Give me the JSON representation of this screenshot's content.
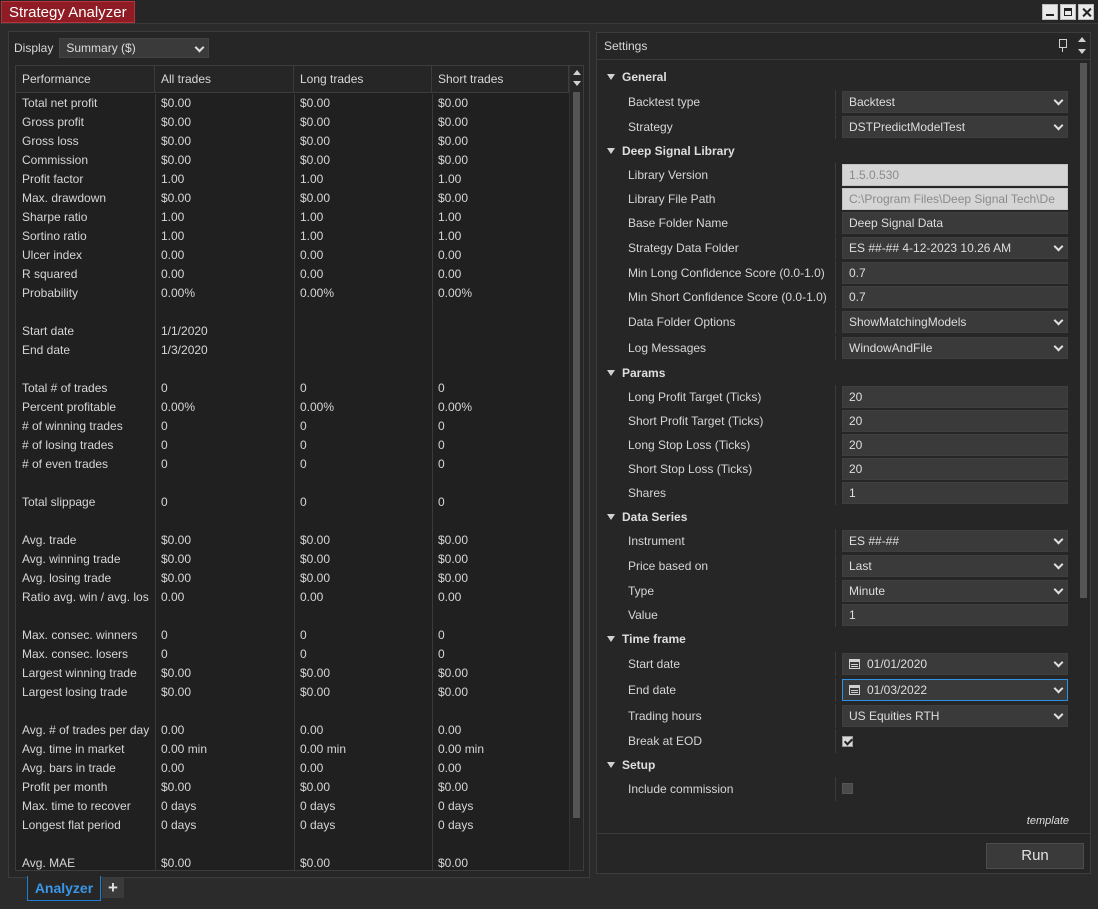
{
  "window": {
    "title": "Strategy Analyzer"
  },
  "display": {
    "label": "Display",
    "value": "Summary ($)"
  },
  "grid": {
    "headers": [
      "Performance",
      "All trades",
      "Long trades",
      "Short trades"
    ],
    "rows": [
      [
        "Total net profit",
        "$0.00",
        "$0.00",
        "$0.00"
      ],
      [
        "Gross profit",
        "$0.00",
        "$0.00",
        "$0.00"
      ],
      [
        "Gross loss",
        "$0.00",
        "$0.00",
        "$0.00"
      ],
      [
        "Commission",
        "$0.00",
        "$0.00",
        "$0.00"
      ],
      [
        "Profit factor",
        "1.00",
        "1.00",
        "1.00"
      ],
      [
        "Max. drawdown",
        "$0.00",
        "$0.00",
        "$0.00"
      ],
      [
        "Sharpe ratio",
        "1.00",
        "1.00",
        "1.00"
      ],
      [
        "Sortino ratio",
        "1.00",
        "1.00",
        "1.00"
      ],
      [
        "Ulcer index",
        "0.00",
        "0.00",
        "0.00"
      ],
      [
        "R squared",
        "0.00",
        "0.00",
        "0.00"
      ],
      [
        "Probability",
        "0.00%",
        "0.00%",
        "0.00%"
      ],
      [
        "",
        "",
        "",
        ""
      ],
      [
        "Start date",
        "1/1/2020",
        "",
        ""
      ],
      [
        "End date",
        "1/3/2020",
        "",
        ""
      ],
      [
        "",
        "",
        "",
        ""
      ],
      [
        "Total # of trades",
        "0",
        "0",
        "0"
      ],
      [
        "Percent profitable",
        "0.00%",
        "0.00%",
        "0.00%"
      ],
      [
        "# of winning trades",
        "0",
        "0",
        "0"
      ],
      [
        "# of losing trades",
        "0",
        "0",
        "0"
      ],
      [
        "# of even trades",
        "0",
        "0",
        "0"
      ],
      [
        "",
        "",
        "",
        ""
      ],
      [
        "Total slippage",
        "0",
        "0",
        "0"
      ],
      [
        "",
        "",
        "",
        ""
      ],
      [
        "Avg. trade",
        "$0.00",
        "$0.00",
        "$0.00"
      ],
      [
        "Avg. winning trade",
        "$0.00",
        "$0.00",
        "$0.00"
      ],
      [
        "Avg. losing trade",
        "$0.00",
        "$0.00",
        "$0.00"
      ],
      [
        "Ratio avg. win / avg. los",
        "0.00",
        "0.00",
        "0.00"
      ],
      [
        "",
        "",
        "",
        ""
      ],
      [
        "Max. consec. winners",
        "0",
        "0",
        "0"
      ],
      [
        "Max. consec. losers",
        "0",
        "0",
        "0"
      ],
      [
        "Largest winning trade",
        "$0.00",
        "$0.00",
        "$0.00"
      ],
      [
        "Largest losing trade",
        "$0.00",
        "$0.00",
        "$0.00"
      ],
      [
        "",
        "",
        "",
        ""
      ],
      [
        "Avg. # of trades per day",
        "0.00",
        "0.00",
        "0.00"
      ],
      [
        "Avg. time in market",
        "0.00 min",
        "0.00 min",
        "0.00 min"
      ],
      [
        "Avg. bars in trade",
        "0.00",
        "0.00",
        "0.00"
      ],
      [
        "Profit per month",
        "$0.00",
        "$0.00",
        "$0.00"
      ],
      [
        "Max. time to recover",
        "0 days",
        "0 days",
        "0 days"
      ],
      [
        "Longest flat period",
        "0 days",
        "0 days",
        "0 days"
      ],
      [
        "",
        "",
        "",
        ""
      ],
      [
        "Avg. MAE",
        "$0.00",
        "$0.00",
        "$0.00"
      ]
    ]
  },
  "tabs": {
    "active": "Analyzer",
    "add": "+"
  },
  "settings": {
    "title": "Settings",
    "sections": {
      "general": "General",
      "dsl": "Deep Signal Library",
      "params": "Params",
      "data_series": "Data Series",
      "time_frame": "Time frame",
      "setup": "Setup"
    },
    "labels": {
      "backtest_type": "Backtest type",
      "strategy": "Strategy",
      "library_version": "Library Version",
      "library_file_path": "Library File Path",
      "base_folder_name": "Base Folder Name",
      "strategy_data_folder": "Strategy Data Folder",
      "min_long_conf": "Min Long Confidence Score (0.0-1.0)",
      "min_short_conf": "Min Short Confidence Score (0.0-1.0)",
      "data_folder_options": "Data Folder Options",
      "log_messages": "Log Messages",
      "long_profit_target": "Long Profit Target (Ticks)",
      "short_profit_target": "Short Profit Target (Ticks)",
      "long_stop_loss": "Long Stop Loss (Ticks)",
      "short_stop_loss": "Short Stop Loss (Ticks)",
      "shares": "Shares",
      "instrument": "Instrument",
      "price_based_on": "Price based on",
      "type": "Type",
      "value": "Value",
      "start_date": "Start date",
      "end_date": "End date",
      "trading_hours": "Trading hours",
      "break_at_eod": "Break at EOD",
      "include_commission": "Include commission"
    },
    "values": {
      "backtest_type": "Backtest",
      "strategy": "DSTPredictModelTest",
      "library_version": "1.5.0.530",
      "library_file_path": "C:\\Program Files\\Deep Signal Tech\\De",
      "base_folder_name": "Deep Signal Data",
      "strategy_data_folder": "ES ##-## 4-12-2023 10.26 AM",
      "min_long_conf": "0.7",
      "min_short_conf": "0.7",
      "data_folder_options": "ShowMatchingModels",
      "log_messages": "WindowAndFile",
      "long_profit_target": "20",
      "short_profit_target": "20",
      "long_stop_loss": "20",
      "short_stop_loss": "20",
      "shares": "1",
      "instrument": "ES ##-##",
      "price_based_on": "Last",
      "type": "Minute",
      "value": "1",
      "start_date": "01/01/2020",
      "end_date": "01/03/2022",
      "trading_hours": "US Equities RTH",
      "break_at_eod": true,
      "include_commission": false
    },
    "template_label": "template",
    "run_label": "Run"
  },
  "colors": {
    "title_tab": "#8f1b24",
    "active_tab": "#3a96e6",
    "focus": "#2f8fe3"
  }
}
